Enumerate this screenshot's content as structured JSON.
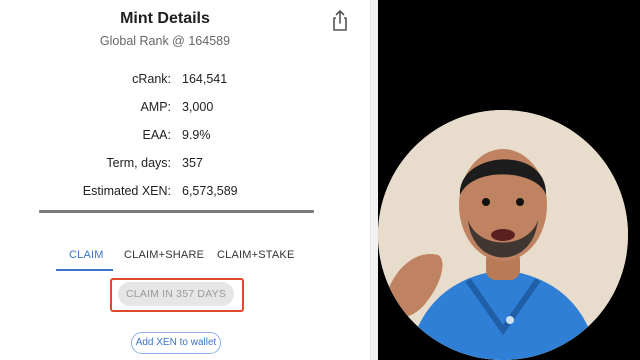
{
  "header": {
    "title": "Mint Details",
    "subtitle": "Global Rank @ 164589"
  },
  "stats": [
    {
      "label": "cRank:",
      "value": "164,541"
    },
    {
      "label": "AMP:",
      "value": "3,000"
    },
    {
      "label": "EAA:",
      "value": "9.9%"
    },
    {
      "label": "Term, days:",
      "value": "357"
    },
    {
      "label": "Estimated XEN:",
      "value": "6,573,589"
    }
  ],
  "tabs": [
    {
      "label": "CLAIM",
      "active": true
    },
    {
      "label": "CLAIM+SHARE",
      "active": false
    },
    {
      "label": "CLAIM+STAKE",
      "active": false
    }
  ],
  "actions": {
    "claim_label": "CLAIM IN 357 DAYS",
    "wallet_label": "Add XEN to wallet"
  },
  "icons": {
    "share": "share-icon"
  },
  "colors": {
    "accent_blue": "#3c73c8",
    "highlight_red": "#e04a2c",
    "disabled_bg": "#e6e6e6",
    "disabled_text": "#9a9a9a"
  }
}
